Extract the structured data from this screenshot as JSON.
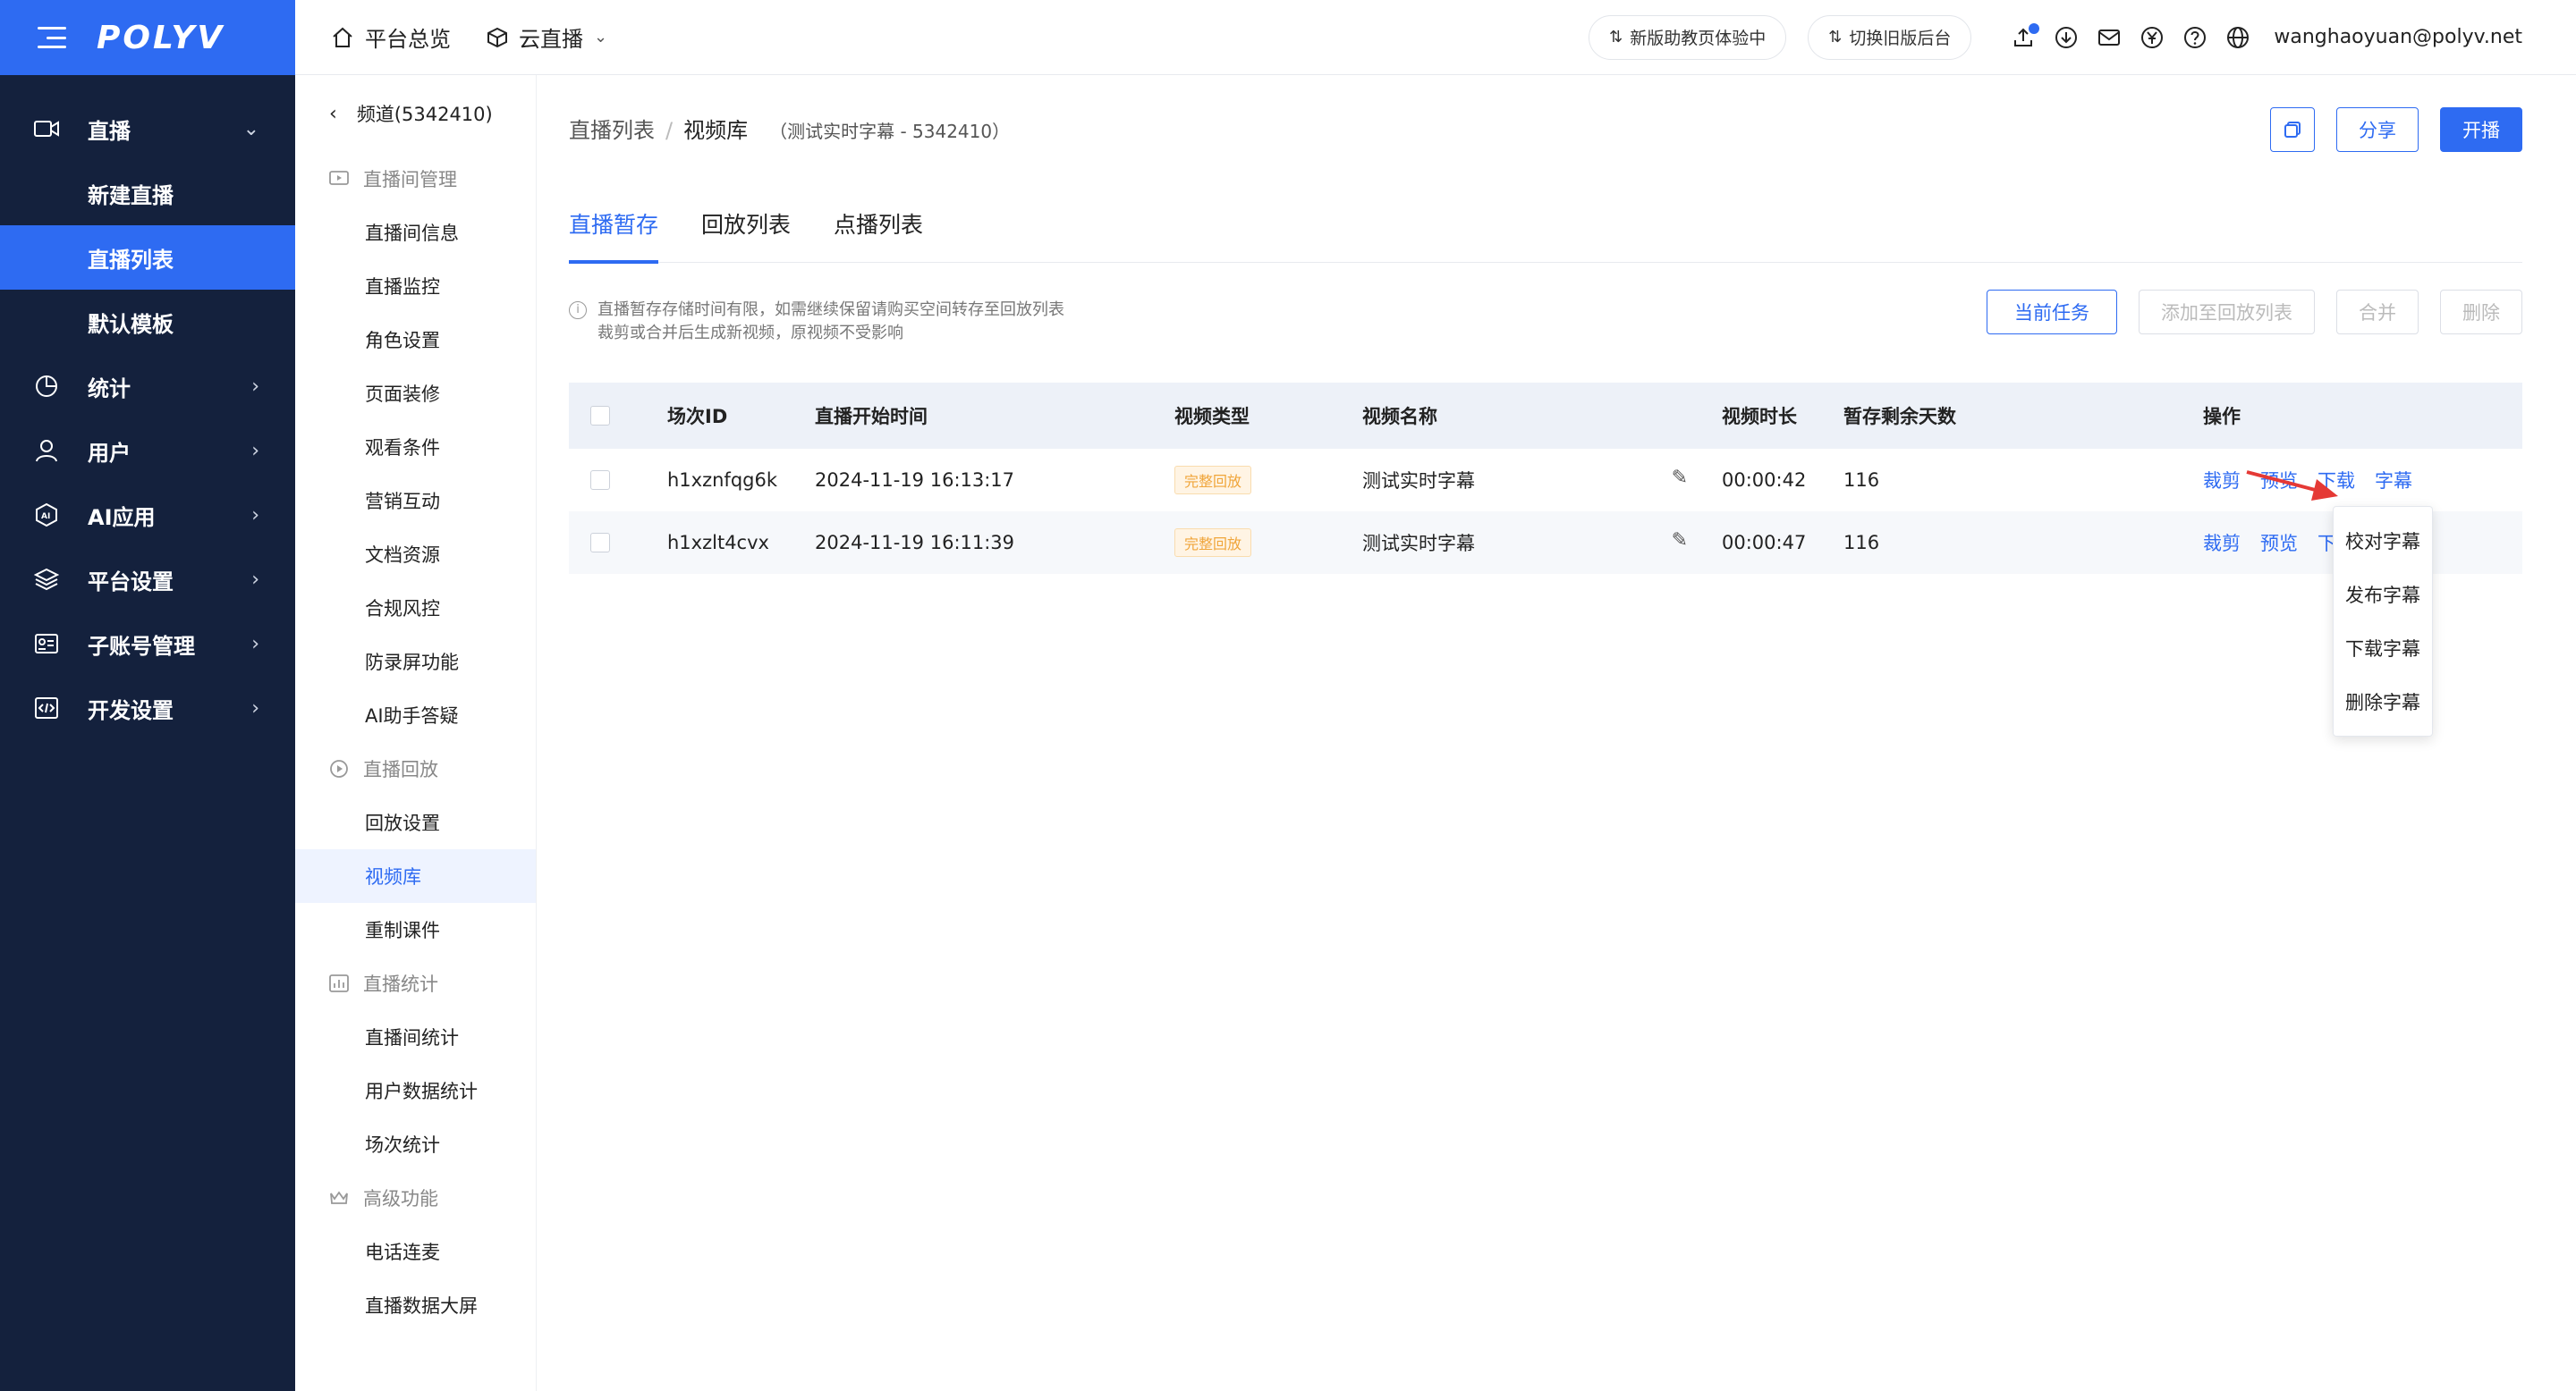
{
  "nav": {
    "logo": "POLYV",
    "live": "直播",
    "live_sub": [
      "新建直播",
      "直播列表",
      "默认模板"
    ],
    "items": [
      {
        "label": "统计",
        "icon": "pie-chart-icon"
      },
      {
        "label": "用户",
        "icon": "user-icon"
      },
      {
        "label": "AI应用",
        "icon": "ai-icon"
      },
      {
        "label": "平台设置",
        "icon": "layers-icon"
      },
      {
        "label": "子账号管理",
        "icon": "id-card-icon"
      },
      {
        "label": "开发设置",
        "icon": "code-icon"
      }
    ]
  },
  "topbar": {
    "overview": "平台总览",
    "cloud_live": "云直播",
    "new_assistant": "新版助教页体验中",
    "switch_old": "切换旧版后台",
    "user_email": "wanghaoyuan@polyv.net"
  },
  "side2": {
    "channel": "频道(5342410)",
    "groups": [
      {
        "title": "直播间管理",
        "items": [
          "直播间信息",
          "直播监控",
          "角色设置",
          "页面装修",
          "观看条件",
          "营销互动",
          "文档资源",
          "合规风控",
          "防录屏功能",
          "AI助手答疑"
        ]
      },
      {
        "title": "直播回放",
        "items": [
          "回放设置",
          "视频库",
          "重制课件"
        ]
      },
      {
        "title": "直播统计",
        "items": [
          "直播间统计",
          "用户数据统计",
          "场次统计"
        ]
      },
      {
        "title": "高级功能",
        "items": [
          "电话连麦",
          "直播数据大屏"
        ]
      }
    ]
  },
  "main": {
    "breadcrumb": {
      "parent": "直播列表",
      "current": "视频库",
      "note": "（测试实时字幕 - 5342410）"
    },
    "share": "分享",
    "start": "开播",
    "tabs": [
      "直播暂存",
      "回放列表",
      "点播列表"
    ],
    "notice_line1": "直播暂存存储时间有限，如需继续保留请购买空间转存至回放列表",
    "notice_line2": "裁剪或合并后生成新视频，原视频不受影响",
    "tools": {
      "current_task": "当前任务",
      "add_to_playback": "添加至回放列表",
      "merge": "合并",
      "delete": "删除"
    },
    "table": {
      "headers": [
        "场次ID",
        "直播开始时间",
        "视频类型",
        "视频名称",
        "视频时长",
        "暂存剩余天数",
        "操作"
      ],
      "rows": [
        {
          "id": "h1xznfqg6k",
          "time": "2024-11-19 16:13:17",
          "type": "完整回放",
          "name": "测试实时字幕",
          "duration": "00:00:42",
          "days": "116",
          "ops": [
            "裁剪",
            "预览",
            "下载",
            "字幕"
          ]
        },
        {
          "id": "h1xzlt4cvx",
          "time": "2024-11-19 16:11:39",
          "type": "完整回放",
          "name": "测试实时字幕",
          "duration": "00:00:47",
          "days": "116",
          "ops": [
            "裁剪",
            "预览",
            "下"
          ]
        }
      ]
    },
    "subtitle_menu": [
      "校对字幕",
      "发布字幕",
      "下载字幕",
      "删除字幕"
    ]
  }
}
